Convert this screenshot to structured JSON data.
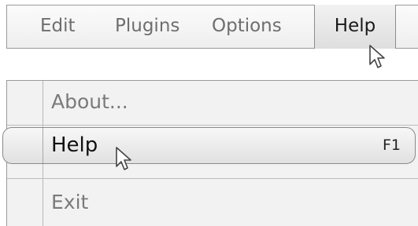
{
  "menubar": {
    "items": [
      {
        "label": "Edit"
      },
      {
        "label": "Plugins"
      },
      {
        "label": "Options"
      },
      {
        "label": "Help",
        "active": true
      }
    ]
  },
  "dropdown": {
    "items": [
      {
        "label": "About...",
        "shortcut": ""
      },
      {
        "label": "Help",
        "shortcut": "F1",
        "highlighted": true
      },
      {
        "label": "Exit",
        "shortcut": ""
      }
    ]
  },
  "icons": {
    "cursor": "pointer-arrow-icon"
  },
  "colors": {
    "menubar_bg": "#eeeeee",
    "highlight_bg": "#e1e1e1",
    "border": "#9a9a9a",
    "disabled_text": "#7a7a7a"
  }
}
